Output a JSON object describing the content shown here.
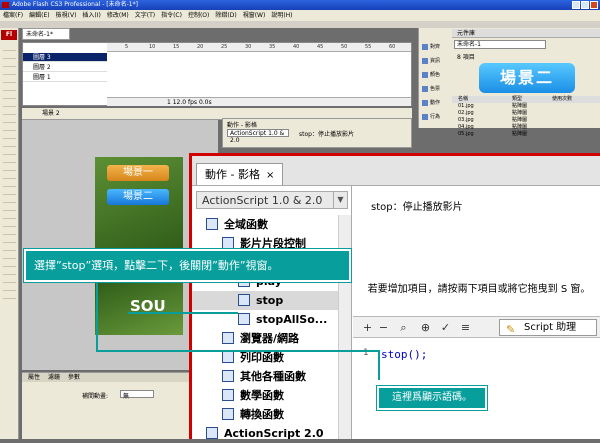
{
  "window": {
    "title": "Adobe Flash CS3 Professional - [未命名-1*]"
  },
  "menu": [
    "檔案(F)",
    "編輯(E)",
    "檢視(V)",
    "插入(I)",
    "修改(M)",
    "文字(T)",
    "指令(C)",
    "控制(O)",
    "除錯(D)",
    "視窗(W)",
    "說明(H)"
  ],
  "toolbox": {
    "logo": "Fl"
  },
  "document": {
    "tab": "未命名-1*",
    "scene": "場景 2"
  },
  "timeline": {
    "frame_numbers": [
      "5",
      "10",
      "15",
      "20",
      "25",
      "30",
      "35",
      "40",
      "45",
      "50",
      "55",
      "60"
    ],
    "layers": [
      "圖層 3",
      "圖層 2",
      "圖層 1"
    ],
    "status": "1    12.0 fps    0.0s"
  },
  "stage": {
    "button1": "場景一",
    "button2": "場景二",
    "bg_text": "SOU"
  },
  "library": {
    "header": "元件庫",
    "dropdown": "未命名-1",
    "count": "8 項目",
    "preview": "場景二",
    "columns": [
      "名稱",
      "類型",
      "使用次數"
    ],
    "items": [
      {
        "name": "01.jpg",
        "type": "點陣圖"
      },
      {
        "name": "02.jpg",
        "type": "點陣圖"
      },
      {
        "name": "03.jpg",
        "type": "點陣圖"
      },
      {
        "name": "04.jpg",
        "type": "點陣圖"
      },
      {
        "name": "05.jpg",
        "type": "點陣圖"
      }
    ],
    "side": [
      "對齊",
      "資訊",
      "顏色",
      "色票",
      "動作",
      "行為"
    ]
  },
  "properties": {
    "tabs": [
      "屬性",
      "濾鏡",
      "參數"
    ],
    "tween": "補間動畫:",
    "tween_value": "無"
  },
  "actions_small": {
    "title": "動作 - 影格",
    "dropdown": "ActionScript 1.0 & 2.0",
    "desc": "stop：停止播放影片"
  },
  "actions_panel": {
    "tab": "動作 - 影格",
    "close": "×",
    "language": "ActionScript 1.0 & 2.0",
    "tree": [
      {
        "label": "全域函數",
        "level": 0
      },
      {
        "label": "影片片段控制",
        "level": 1
      },
      {
        "label": "goto",
        "level": 2
      },
      {
        "label": "play",
        "level": 2
      },
      {
        "label": "stop",
        "level": 2,
        "selected": true
      },
      {
        "label": "stopAllSo...",
        "level": 2
      },
      {
        "label": "瀏覽器/網路",
        "level": 1
      },
      {
        "label": "列印函數",
        "level": 1
      },
      {
        "label": "其他各種函數",
        "level": 1
      },
      {
        "label": "數學函數",
        "level": 1
      },
      {
        "label": "轉換函數",
        "level": 1
      },
      {
        "label": "ActionScript 2.0",
        "level": 0
      }
    ],
    "description": "stop：停止播放影片",
    "hint": "若要增加項目，請按兩下項目或將它拖曳到 S 窗。",
    "script_assist": "Script 助理",
    "code": "stop();",
    "line_number": "1"
  },
  "annotations": {
    "select": "選擇”stop”選項，點擊二下，後關閉”動作”視窗。",
    "code": "這裡爲顯示語碼。"
  },
  "colors": {
    "callout": "#079e9c",
    "highlight_border": "#d10000",
    "titlebar": "#2c64e0"
  }
}
